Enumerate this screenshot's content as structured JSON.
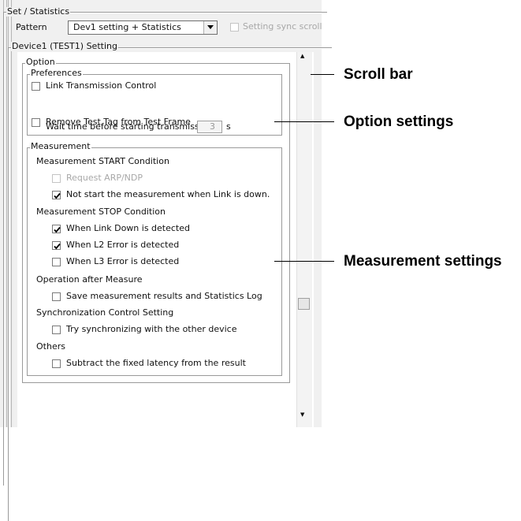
{
  "set_statistics": {
    "title": "Set / Statistics",
    "pattern_label": "Pattern",
    "pattern_value": "Dev1 setting + Statistics",
    "sync_scroll_label": "Setting sync scroll",
    "sync_scroll_checked": false,
    "sync_scroll_enabled": false
  },
  "device": {
    "title": "Device1 (TEST1) Setting"
  },
  "option": {
    "title": "Option",
    "preferences": {
      "title": "Preferences",
      "link_transmission_control": {
        "label": "Link Transmission Control",
        "checked": false
      },
      "wait_time_label": "Wait time before starting transmission",
      "wait_time_value": "3",
      "wait_time_unit": "s",
      "remove_test_tag": {
        "label": "Remove Test Tag from Test Frame",
        "checked": false
      }
    },
    "measurement": {
      "title": "Measurement",
      "start_condition_label": "Measurement START Condition",
      "request_arp_ndp": {
        "label": "Request ARP/NDP",
        "checked": false,
        "enabled": false
      },
      "not_start_when_link_down": {
        "label": "Not start the measurement when Link is down.",
        "checked": true
      },
      "stop_condition_label": "Measurement STOP Condition",
      "when_link_down": {
        "label": "When Link Down is detected",
        "checked": true
      },
      "when_l2_error": {
        "label": "When L2 Error is detected",
        "checked": true
      },
      "when_l3_error": {
        "label": "When L3 Error is detected",
        "checked": false
      },
      "operation_after_label": "Operation after Measure",
      "save_results": {
        "label": "Save measurement results and Statistics Log",
        "checked": false
      },
      "sync_control_label": "Synchronization Control Setting",
      "try_sync": {
        "label": "Try synchronizing with the other device",
        "checked": false
      },
      "others_label": "Others",
      "subtract_latency": {
        "label": "Subtract the fixed latency from the result",
        "checked": false
      }
    }
  },
  "scrollbar": {
    "up_arrow": "▲",
    "down_arrow": "▼"
  },
  "callouts": {
    "scroll_bar": "Scroll bar",
    "option_settings": "Option settings",
    "measurement_settings": "Measurement settings"
  }
}
